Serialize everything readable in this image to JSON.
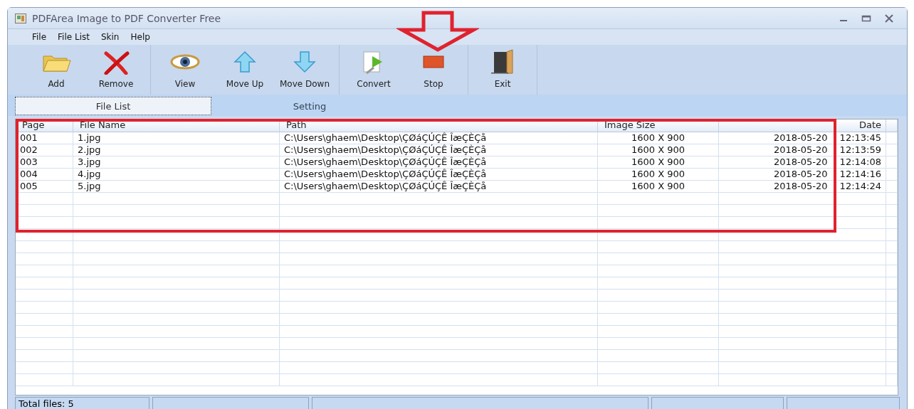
{
  "window": {
    "title": "PDFArea Image to PDF Converter Free"
  },
  "menu": [
    "File",
    "File List",
    "Skin",
    "Help"
  ],
  "toolbar": [
    {
      "kind": "add",
      "label": "Add"
    },
    {
      "kind": "remove",
      "label": "Remove"
    },
    {
      "kind": "view",
      "label": "View"
    },
    {
      "kind": "up",
      "label": "Move Up"
    },
    {
      "kind": "down",
      "label": "Move Down"
    },
    {
      "kind": "convert",
      "label": "Convert"
    },
    {
      "kind": "stop",
      "label": "Stop"
    },
    {
      "kind": "exit",
      "label": "Exit"
    }
  ],
  "tabs": [
    {
      "label": "File List",
      "selected": true
    },
    {
      "label": "Setting",
      "selected": false
    }
  ],
  "table": {
    "columns": [
      "Page",
      "File Name",
      "Path",
      "Image Size",
      "Date"
    ],
    "rows": [
      [
        "001",
        "1.jpg",
        "C:\\Users\\ghaem\\Desktop\\ÇØáÇÚÇÊ ÎæÇÈÇå",
        "1600 X 900",
        "2018-05-20 12:13:45"
      ],
      [
        "002",
        "2.jpg",
        "C:\\Users\\ghaem\\Desktop\\ÇØáÇÚÇÊ ÎæÇÈÇå",
        "1600 X 900",
        "2018-05-20 12:13:59"
      ],
      [
        "003",
        "3.jpg",
        "C:\\Users\\ghaem\\Desktop\\ÇØáÇÚÇÊ ÎæÇÈÇå",
        "1600 X 900",
        "2018-05-20 12:14:08"
      ],
      [
        "004",
        "4.jpg",
        "C:\\Users\\ghaem\\Desktop\\ÇØáÇÚÇÊ ÎæÇÈÇå",
        "1600 X 900",
        "2018-05-20 12:14:16"
      ],
      [
        "005",
        "5.jpg",
        "C:\\Users\\ghaem\\Desktop\\ÇØáÇÚÇÊ ÎæÇÈÇå",
        "1600 X 900",
        "2018-05-20 12:14:24"
      ]
    ]
  },
  "status_bar": [
    "Total files: 5"
  ]
}
